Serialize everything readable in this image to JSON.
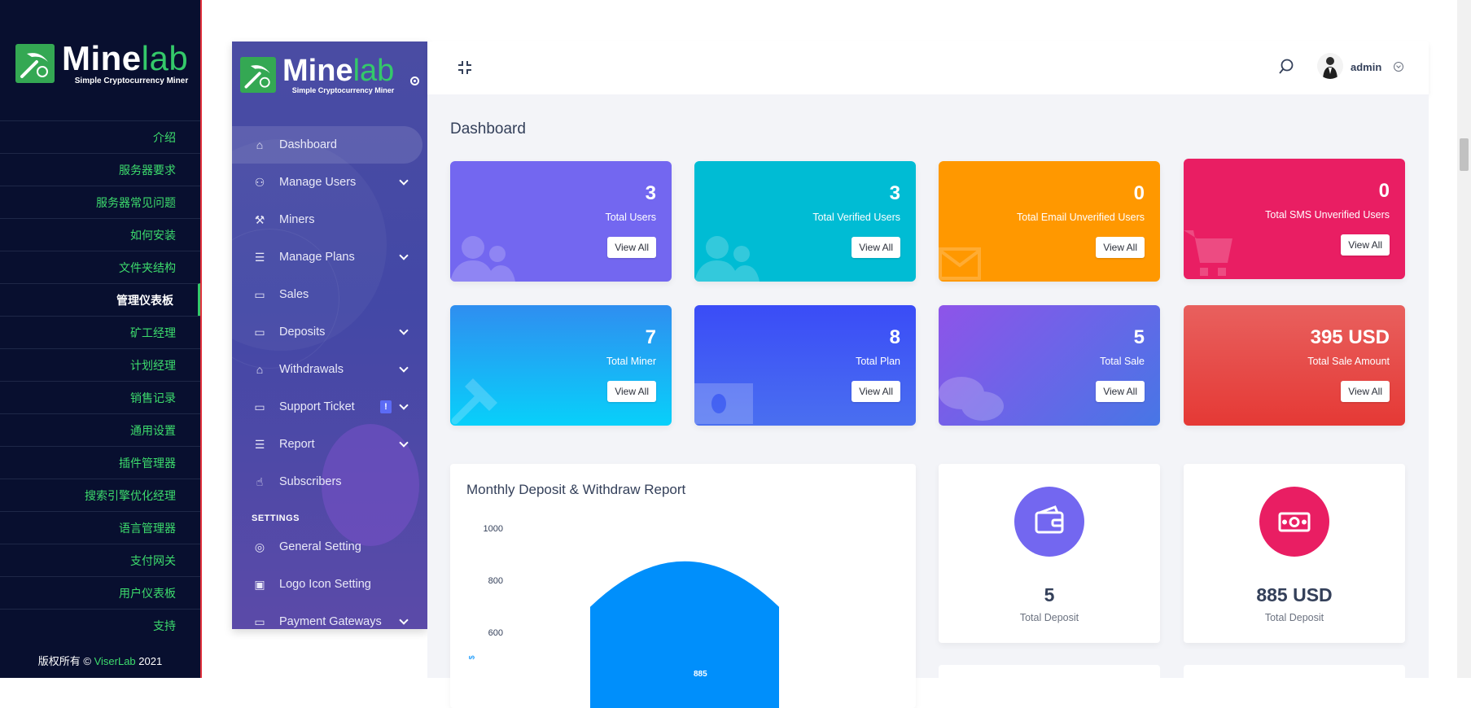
{
  "brand": {
    "name_main": "Mine",
    "name_accent": "lab",
    "tagline": "Simple Cryptocurrency Miner"
  },
  "doc_menu": [
    {
      "label": "介绍"
    },
    {
      "label": "服务器要求"
    },
    {
      "label": "服务器常见问题"
    },
    {
      "label": "如何安装"
    },
    {
      "label": "文件夹结构"
    },
    {
      "label": "管理仪表板",
      "active": true
    },
    {
      "label": "矿工经理"
    },
    {
      "label": "计划经理"
    },
    {
      "label": "销售记录"
    },
    {
      "label": "通用设置"
    },
    {
      "label": "插件管理器"
    },
    {
      "label": "搜索引擎优化经理"
    },
    {
      "label": "语言管理器"
    },
    {
      "label": "支付网关"
    },
    {
      "label": "用户仪表板"
    },
    {
      "label": "支持"
    }
  ],
  "doc_footer": {
    "prefix": "版权所有 ©",
    "company": "ViserLab",
    "year": "2021"
  },
  "admin_menu": [
    {
      "label": "Dashboard",
      "icon": "home-icon",
      "active": true
    },
    {
      "label": "Manage Users",
      "icon": "users-icon",
      "dropdown": true
    },
    {
      "label": "Miners",
      "icon": "pickaxe-icon"
    },
    {
      "label": "Manage Plans",
      "icon": "list-icon",
      "dropdown": true
    },
    {
      "label": "Sales",
      "icon": "money-icon"
    },
    {
      "label": "Deposits",
      "icon": "credit-card-icon",
      "dropdown": true
    },
    {
      "label": "Withdrawals",
      "icon": "bank-icon",
      "dropdown": true
    },
    {
      "label": "Support Ticket",
      "icon": "ticket-icon",
      "dropdown": true,
      "badge": "!"
    },
    {
      "label": "Report",
      "icon": "list-icon",
      "dropdown": true
    },
    {
      "label": "Subscribers",
      "icon": "thumbs-up-icon"
    }
  ],
  "settings_section": "SETTINGS",
  "settings_menu": [
    {
      "label": "General Setting",
      "icon": "life-ring-icon"
    },
    {
      "label": "Logo Icon Setting",
      "icon": "images-icon"
    },
    {
      "label": "Payment Gateways",
      "icon": "credit-card-icon",
      "dropdown": true
    }
  ],
  "topbar": {
    "username": "admin"
  },
  "page_title": "Dashboard",
  "stat_cards": [
    {
      "value": "3",
      "label": "Total Users",
      "button": "View All",
      "icon": "users-icon",
      "color": "#7367f0"
    },
    {
      "value": "3",
      "label": "Total Verified Users",
      "button": "View All",
      "icon": "users-icon",
      "color": "#00bcd4"
    },
    {
      "value": "0",
      "label": "Total Email Unverified Users",
      "button": "View All",
      "icon": "envelope-icon",
      "color": "#ff9800"
    },
    {
      "value": "0",
      "label": "Total SMS Unverified Users",
      "button": "View All",
      "icon": "cart-icon",
      "color": "#e91e63"
    },
    {
      "value": "7",
      "label": "Total Miner",
      "button": "View All",
      "icon": "pickaxe-icon",
      "color": "#1e9ff2"
    },
    {
      "value": "8",
      "label": "Total Plan",
      "button": "View All",
      "icon": "money-icon",
      "color": "#3d5afe"
    },
    {
      "value": "5",
      "label": "Total Sale",
      "button": "View All",
      "icon": "comments-icon",
      "color": "#7e57c2"
    },
    {
      "value": "395 USD",
      "label": "Total Sale Amount",
      "button": "View All",
      "icon": "none",
      "color": "#e53935"
    }
  ],
  "report": {
    "title": "Monthly Deposit & Withdraw Report",
    "y_ticks": [
      "1000",
      "800",
      "600"
    ],
    "axis_symbol": "$",
    "bar_label": "885"
  },
  "chart_data": {
    "type": "bar",
    "title": "Monthly Deposit & Withdraw Report",
    "ylim": [
      0,
      1000
    ],
    "yticks": [
      600,
      800,
      1000
    ],
    "values": [
      885
    ],
    "colors": [
      "#008ffb"
    ]
  },
  "kpi_cards": [
    {
      "value": "5",
      "label": "Total Deposit",
      "icon": "wallet-icon",
      "color": "#7367f0"
    },
    {
      "value": "885 USD",
      "label": "Total Deposit",
      "icon": "money-icon",
      "color": "#e91e63"
    }
  ]
}
